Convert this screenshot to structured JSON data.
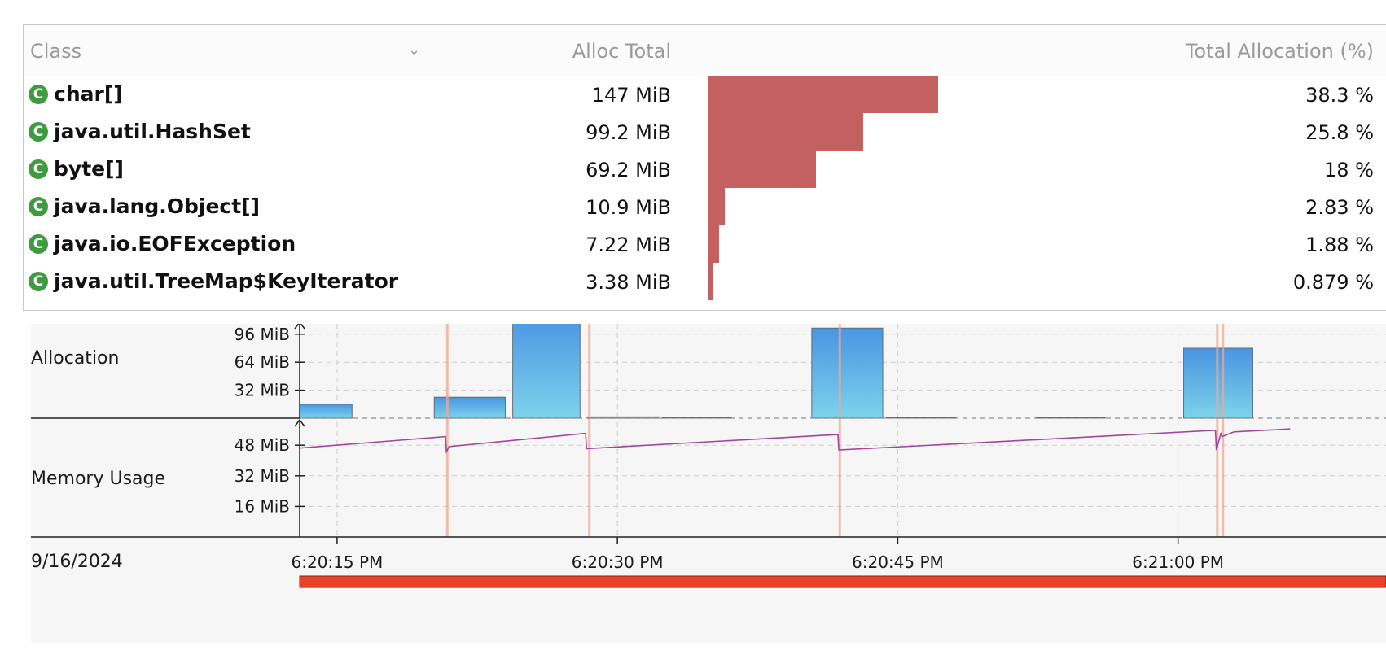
{
  "table": {
    "columns": {
      "class": "Class",
      "alloc_total": "Alloc Total",
      "total_allocation": "Total Allocation (%)"
    },
    "rows": [
      {
        "icon": "class-icon",
        "name": "char[]",
        "alloc": "147 MiB",
        "pct": "38.3 %",
        "fraction": 0.383
      },
      {
        "icon": "class-icon",
        "name": "java.util.HashSet",
        "alloc": "99.2 MiB",
        "pct": "25.8 %",
        "fraction": 0.258
      },
      {
        "icon": "class-icon",
        "name": "byte[]",
        "alloc": "69.2 MiB",
        "pct": "18 %",
        "fraction": 0.18
      },
      {
        "icon": "class-icon",
        "name": "java.lang.Object[]",
        "alloc": "10.9 MiB",
        "pct": "2.83 %",
        "fraction": 0.0283
      },
      {
        "icon": "class-icon",
        "name": "java.io.EOFException",
        "alloc": "7.22 MiB",
        "pct": "1.88 %",
        "fraction": 0.0188
      },
      {
        "icon": "class-icon",
        "name": "java.util.TreeMap$KeyIterator",
        "alloc": "3.38 MiB",
        "pct": "0.879 %",
        "fraction": 0.00879
      }
    ]
  },
  "charts": {
    "allocation_label": "Allocation",
    "memory_label": "Memory Usage",
    "date": "9/16/2024",
    "colors": {
      "bar_top": "#4a95e2",
      "bar_bottom": "#7dd3eb",
      "gc_line": "#f0a894",
      "usage_line": "#a8439a",
      "time_bar": "#e8412a",
      "class_bar": "#c46160"
    }
  },
  "chart_data": [
    {
      "type": "bar",
      "title": "Allocation",
      "y_ticks": [
        "32 MiB",
        "64 MiB",
        "96 MiB"
      ],
      "y_tick_values": [
        32,
        64,
        96
      ],
      "ylim": [
        0,
        120
      ],
      "x_ticks": [
        "6:20:15 PM",
        "6:20:30 PM",
        "6:20:45 PM",
        "6:21:00 PM"
      ],
      "x_tick_seconds": [
        15,
        30,
        45,
        60
      ],
      "xlim_seconds": [
        13,
        66
      ],
      "bars": [
        {
          "start": 13.0,
          "end": 15.8,
          "value": 16
        },
        {
          "start": 20.2,
          "end": 24.0,
          "value": 24
        },
        {
          "start": 24.4,
          "end": 28.0,
          "value": 118
        },
        {
          "start": 28.4,
          "end": 32.2,
          "value": 1.5
        },
        {
          "start": 32.4,
          "end": 36.1,
          "value": 1.0
        },
        {
          "start": 40.4,
          "end": 44.2,
          "value": 103
        },
        {
          "start": 44.4,
          "end": 48.1,
          "value": 0.8
        },
        {
          "start": 52.4,
          "end": 56.1,
          "value": 0.8
        },
        {
          "start": 60.3,
          "end": 64.0,
          "value": 80
        }
      ],
      "gc_markers_seconds": [
        20.9,
        28.5,
        41.9,
        62.1,
        62.4
      ]
    },
    {
      "type": "line",
      "title": "Memory Usage",
      "y_ticks": [
        "16 MiB",
        "32 MiB",
        "48 MiB"
      ],
      "y_tick_values": [
        16,
        32,
        48
      ],
      "ylim": [
        0,
        64
      ],
      "x_ticks": [
        "6:20:15 PM",
        "6:20:30 PM",
        "6:20:45 PM",
        "6:21:00 PM"
      ],
      "x_tick_seconds": [
        15,
        30,
        45,
        60
      ],
      "xlim_seconds": [
        13,
        66
      ],
      "series": [
        {
          "points": [
            [
              13.0,
              46.5
            ],
            [
              20.8,
              52.5
            ],
            [
              20.85,
              44.6
            ],
            [
              21.0,
              47.3
            ],
            [
              28.3,
              54.2
            ],
            [
              28.35,
              46.2
            ],
            [
              41.8,
              53.6
            ],
            [
              41.85,
              45.5
            ],
            [
              62.0,
              55.8
            ],
            [
              62.05,
              45.5
            ],
            [
              62.3,
              54.5
            ],
            [
              62.35,
              52.5
            ],
            [
              63.0,
              55.0
            ],
            [
              66.0,
              56.5
            ]
          ]
        }
      ]
    }
  ]
}
